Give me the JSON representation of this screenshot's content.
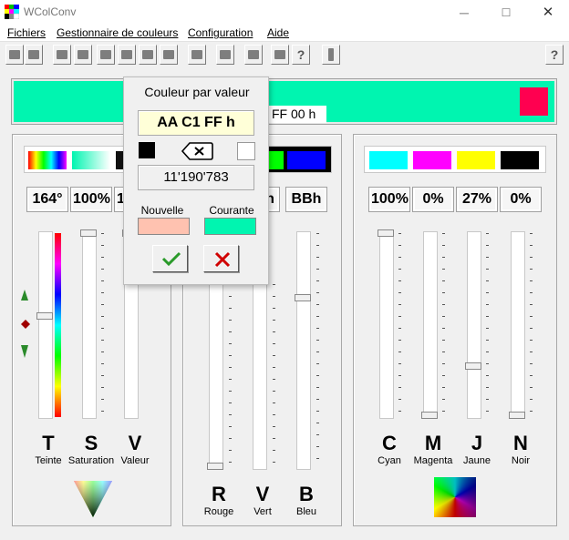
{
  "window": {
    "title": "WColConv",
    "minimize": "─",
    "maximize": "☐",
    "close": "✕"
  },
  "menu": {
    "items": [
      "Fichiers",
      "Gestionnaire de couleurs",
      "Configuration",
      "Aide"
    ]
  },
  "toolbar": {
    "help_label": "?",
    "hex_help": "?"
  },
  "strip": {
    "hex_label": "FF 00 h",
    "color": "#00f5b0",
    "accent": "#ff0050"
  },
  "hsv": {
    "values": [
      "164°",
      "100%",
      "1"
    ],
    "letters": [
      "T",
      "S",
      "V"
    ],
    "labels": [
      "Teinte",
      "Saturation",
      "Valeur"
    ],
    "levels": [
      0.545,
      1.0,
      1.0
    ]
  },
  "rgb": {
    "values": [
      "h",
      "BBh"
    ],
    "letters": [
      "R",
      "V",
      "B"
    ],
    "labels": [
      "Rouge",
      "Vert",
      "Bleu"
    ]
  },
  "cmyk": {
    "values": [
      "100%",
      "0%",
      "27%",
      "0%"
    ],
    "letters": [
      "C",
      "M",
      "J",
      "N"
    ],
    "labels": [
      "Cyan",
      "Magenta",
      "Jaune",
      "Noir"
    ],
    "levels": [
      1.0,
      0.0,
      0.27,
      0.0
    ]
  },
  "popup": {
    "title": "Couleur par valeur",
    "hex_value": "AA C1 FF h",
    "decimal_value": "11'190'783",
    "new_label": "Nouvelle",
    "current_label": "Courante",
    "new_color": "#ffc2b0",
    "current_color": "#00f5b0"
  }
}
